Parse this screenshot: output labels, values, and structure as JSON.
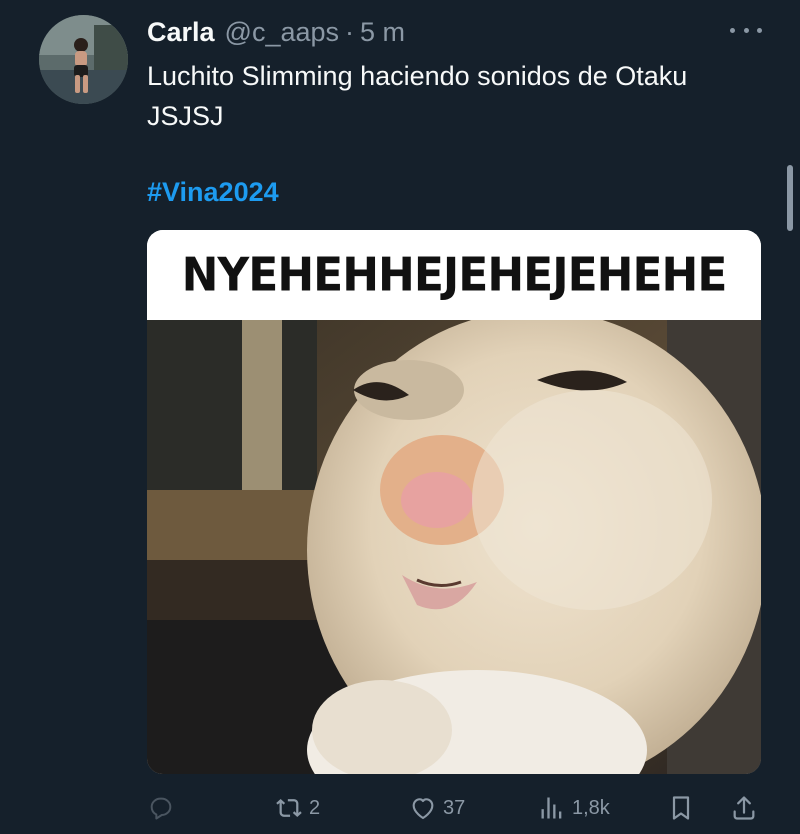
{
  "tweet": {
    "display_name": "Carla",
    "handle": "@c_aaps",
    "separator": "·",
    "time": "5 m",
    "text": "Luchito Slimming haciendo sonidos de Otaku JSJSJ",
    "hashtag": "#Vina2024",
    "media": {
      "caption": "NYEHEHHEJEHEJEHEHE"
    }
  },
  "actions": {
    "reply": {
      "icon": "reply-icon",
      "count": ""
    },
    "retweet": {
      "icon": "retweet-icon",
      "count": "2"
    },
    "like": {
      "icon": "heart-icon",
      "count": "37"
    },
    "views": {
      "icon": "views-icon",
      "count": "1,8k"
    },
    "bookmark": {
      "icon": "bookmark-icon"
    },
    "share": {
      "icon": "share-icon"
    }
  },
  "colors": {
    "background": "#15202b",
    "text": "#f7f9f9",
    "secondary": "#8b98a5",
    "accent": "#1d9bf0"
  }
}
